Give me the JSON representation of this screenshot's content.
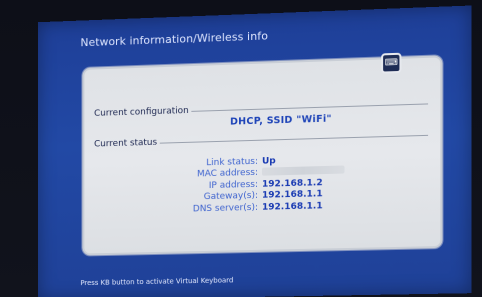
{
  "screen": {
    "title": "Network information/Wireless info",
    "keyboard_icon": "⌨",
    "hint": "Press KB button to activate Virtual Keyboard"
  },
  "config": {
    "label": "Current configuration",
    "value": "DHCP, SSID \"WiFi\""
  },
  "status": {
    "label": "Current status",
    "rows": [
      {
        "key": "Link status:",
        "value": "Up"
      },
      {
        "key": "MAC address:",
        "value": ""
      },
      {
        "key": "IP address:",
        "value": "192.168.1.2"
      },
      {
        "key": "Gateway(s):",
        "value": "192.168.1.1"
      },
      {
        "key": "DNS server(s):",
        "value": "192.168.1.1"
      }
    ]
  },
  "colors": {
    "background": "#2249a5",
    "panel": "#e3e6ea",
    "accent": "#1a3bb3"
  }
}
